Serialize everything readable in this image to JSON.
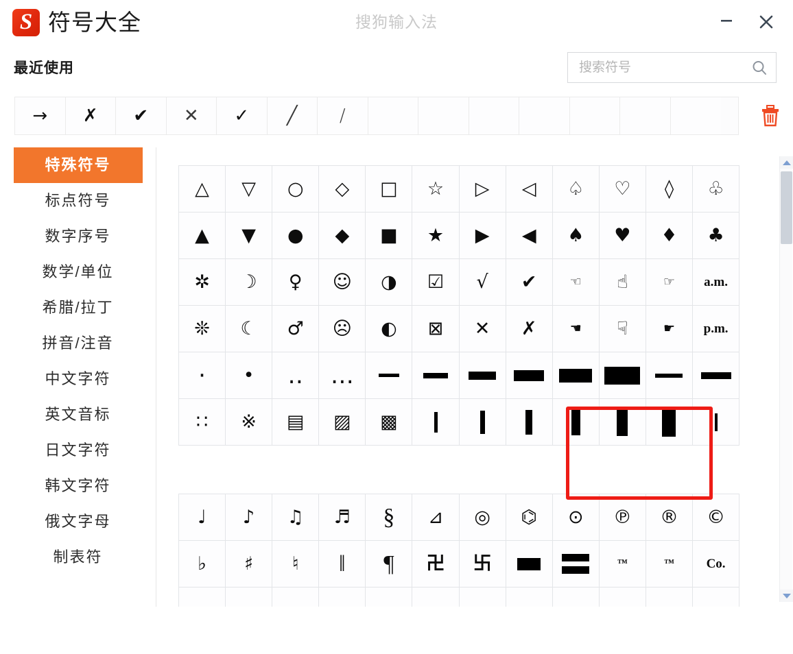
{
  "window": {
    "title": "符号大全",
    "logo_letter": "S",
    "watermark": "搜狗输入法",
    "minimize_label": "−",
    "close_label": "✕"
  },
  "search": {
    "placeholder": "搜索符号",
    "value": "",
    "icon": "search-icon"
  },
  "recent": {
    "label": "最近使用",
    "clear_icon": "trash-icon",
    "symbols": [
      "→",
      "✗",
      "✔",
      "✕",
      "✓",
      "╱",
      "∕"
    ],
    "empty_slots": 7
  },
  "sidebar": {
    "items": [
      {
        "label": "特殊符号",
        "active": true
      },
      {
        "label": "标点符号",
        "active": false
      },
      {
        "label": "数字序号",
        "active": false
      },
      {
        "label": "数学/单位",
        "active": false
      },
      {
        "label": "希腊/拉丁",
        "active": false
      },
      {
        "label": "拼音/注音",
        "active": false
      },
      {
        "label": "中文字符",
        "active": false
      },
      {
        "label": "英文音标",
        "active": false
      },
      {
        "label": "日文字符",
        "active": false
      },
      {
        "label": "韩文字符",
        "active": false
      },
      {
        "label": "俄文字母",
        "active": false
      },
      {
        "label": "制表符",
        "active": false
      }
    ]
  },
  "grids": {
    "block_1": {
      "rows": [
        [
          "△",
          "▽",
          "○",
          "◇",
          "□",
          "☆",
          "▷",
          "◁",
          "♤",
          "♡",
          "◊",
          "♧"
        ],
        [
          "▲",
          "▼",
          "●",
          "◆",
          "■",
          "★",
          "▶",
          "◀",
          "♠",
          "♥",
          "♦",
          "♣"
        ],
        [
          "✲",
          "☽",
          "♀",
          "☺",
          "◑",
          "☑",
          "√",
          "✔",
          "☜",
          "☝",
          "☞",
          "a.m."
        ],
        [
          "❊",
          "☾",
          "♂",
          "☹",
          "◐",
          "⊠",
          "✕",
          "✗",
          "☚",
          "☟",
          "☛",
          "p.m."
        ],
        [
          "·",
          "•",
          "‥",
          "…",
          "▬",
          "▬",
          "▬",
          "▬",
          "▬",
          "▬",
          "▬",
          "▬"
        ],
        [
          "∷",
          "※",
          "▤",
          "▨",
          "▩",
          "▏",
          "▎",
          "▍",
          "▌",
          "▋",
          "▊",
          "▉"
        ]
      ]
    },
    "block_2": {
      "rows": [
        [
          "♩",
          "♪",
          "♫",
          "♬",
          "§",
          "⊿",
          "◎",
          "⌬",
          "⊙",
          "℗",
          "®",
          "©"
        ],
        [
          "♭",
          "♯",
          "♮",
          "‖",
          "¶",
          "卍",
          "卐",
          "▄",
          "═",
          "™",
          "™",
          "Co."
        ]
      ]
    }
  },
  "annotation": {
    "highlight_label": "check-and-cross-symbols-highlight",
    "color": "#ee1c16"
  },
  "scrollbar": {
    "up_arrow": "scroll-up-arrow",
    "down_arrow": "scroll-down-arrow",
    "thumb": "scroll-thumb"
  }
}
